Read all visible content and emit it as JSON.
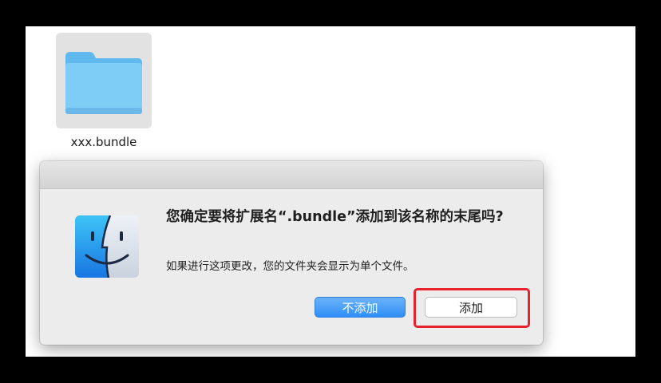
{
  "finder": {
    "folder": {
      "name": "xxx.bundle",
      "icon": "folder-icon"
    }
  },
  "dialog": {
    "icon": "finder-icon",
    "title": "您确定要将扩展名“.bundle”添加到该名称的末尾吗?",
    "message": "如果进行这项更改，您的文件夹会显示为单个文件。",
    "buttons": {
      "dont_add": "不添加",
      "add": "添加"
    }
  },
  "colors": {
    "accent": "#2f8ff5",
    "highlight": "#e5222d",
    "folder": "#6fc4f4"
  }
}
